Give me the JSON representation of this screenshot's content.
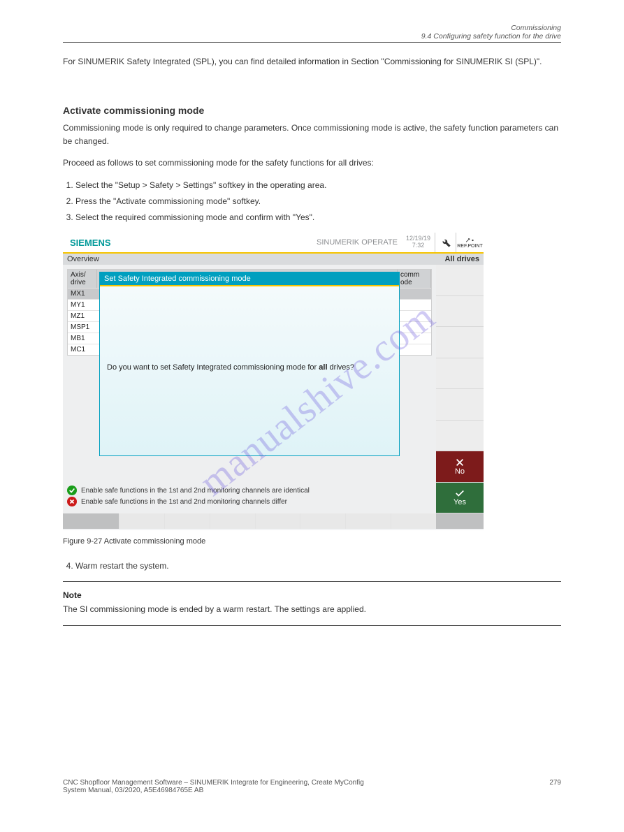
{
  "running_head": {
    "chapter": "Commissioning",
    "section": "9.4 Configuring safety function for the drive"
  },
  "pre_text": "For SINUMERIK Safety Integrated (SPL), you can find detailed information in Section \"Commissioning for SINUMERIK SI (SPL)\".",
  "h1": "Activate commissioning mode",
  "p1": "Commissioning mode is only required to change parameters. Once commissioning mode is active, the safety function parameters can be changed.",
  "p2": "Proceed as follows to set commissioning mode for the safety functions for all drives:",
  "ol": [
    "Select the \"Setup > Safety > Settings\" softkey in the operating area.",
    "Press the \"Activate commissioning mode\" softkey.",
    "Select the required commissioning mode and confirm with \"Yes\"."
  ],
  "screenshot": {
    "brand": "SIEMENS",
    "product": "SINUMERIK OPERATE",
    "date": "12/19/19",
    "time": "7:32",
    "tool_refpoint": "REF.POINT",
    "subheader_left": "Overview",
    "subheader_right": "All drives",
    "table": {
      "col1": "Axis/\ndrive",
      "col3_a": "comm",
      "col3_b": "ode",
      "rows": [
        "MX1",
        "MY1",
        "MZ1",
        "MSP1",
        "MB1",
        "MC1"
      ]
    },
    "dialog": {
      "title": "Set Safety Integrated commissioning mode",
      "body_pre": "Do you want to set Safety Integrated commissioning mode for ",
      "body_bold": "all",
      "body_post": " drives?"
    },
    "legend_ok": "Enable safe functions in the 1st and 2nd monitoring channels are identical",
    "legend_err": "Enable safe functions in the 1st and 2nd monitoring channels differ",
    "sk_no": "No",
    "sk_yes": "Yes"
  },
  "fig_caption": "Figure 9-27   Activate commissioning mode",
  "ol2": [
    "Warm restart the system."
  ],
  "note_label": "Note",
  "note_body": "The SI commissioning mode is ended by a warm restart. The settings are applied.",
  "footer": {
    "book": "CNC Shopfloor Management Software – SINUMERIK Integrate for Engineering, Create MyConfig",
    "doc": "System Manual, 03/2020, A5E46984765E AB",
    "page": "279"
  },
  "watermark": "manualshive.com"
}
